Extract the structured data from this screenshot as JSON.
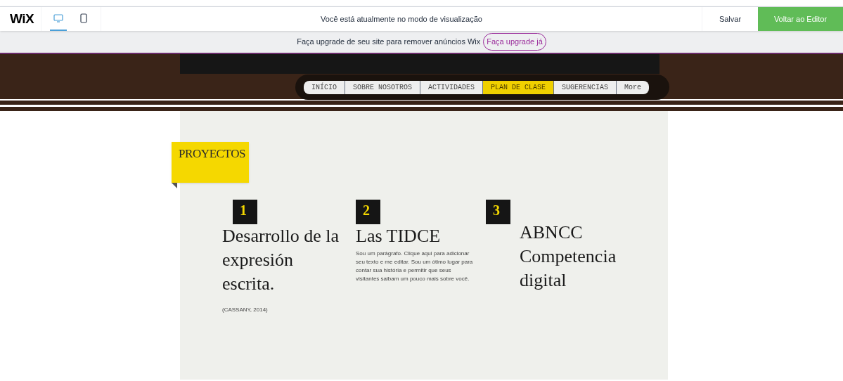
{
  "top_bar": {
    "logo": "WiX",
    "devices": [
      {
        "kind": "desktop",
        "selected": true
      },
      {
        "kind": "mobile",
        "selected": false
      }
    ],
    "message": "Você está atualmente no modo de visualização",
    "save": "Salvar",
    "back": "Voltar ao Editor"
  },
  "upgrade_bar": {
    "text": "Faça upgrade de seu site para remover anúncios Wix",
    "link": "Faça upgrade já"
  },
  "nav": [
    {
      "label": "INÍCIO",
      "selected": false
    },
    {
      "label": "SOBRE NOSOTROS",
      "selected": false
    },
    {
      "label": "ACTIVIDADES",
      "selected": false
    },
    {
      "label": "PLAN DE CLASE",
      "selected": true
    },
    {
      "label": "SUGERENCIAS",
      "selected": false
    },
    {
      "label": "More",
      "selected": false
    }
  ],
  "section_tag": "PROYECTOS",
  "projects": [
    {
      "number": "1",
      "title": "Desarrollo de la expresión escrita.",
      "text": "(CASSANY, 2014)"
    },
    {
      "number": "2",
      "title": "Las TIDCE",
      "text": "Sou um parágrafo. Clique aqui para adicionar seu texto e me editar. Sou um ótimo lugar para contar sua história e permitir que seus visitantes saibam um pouco mais sobre você."
    },
    {
      "number": "3",
      "title": "ABNCC Competencia digital"
    }
  ]
}
